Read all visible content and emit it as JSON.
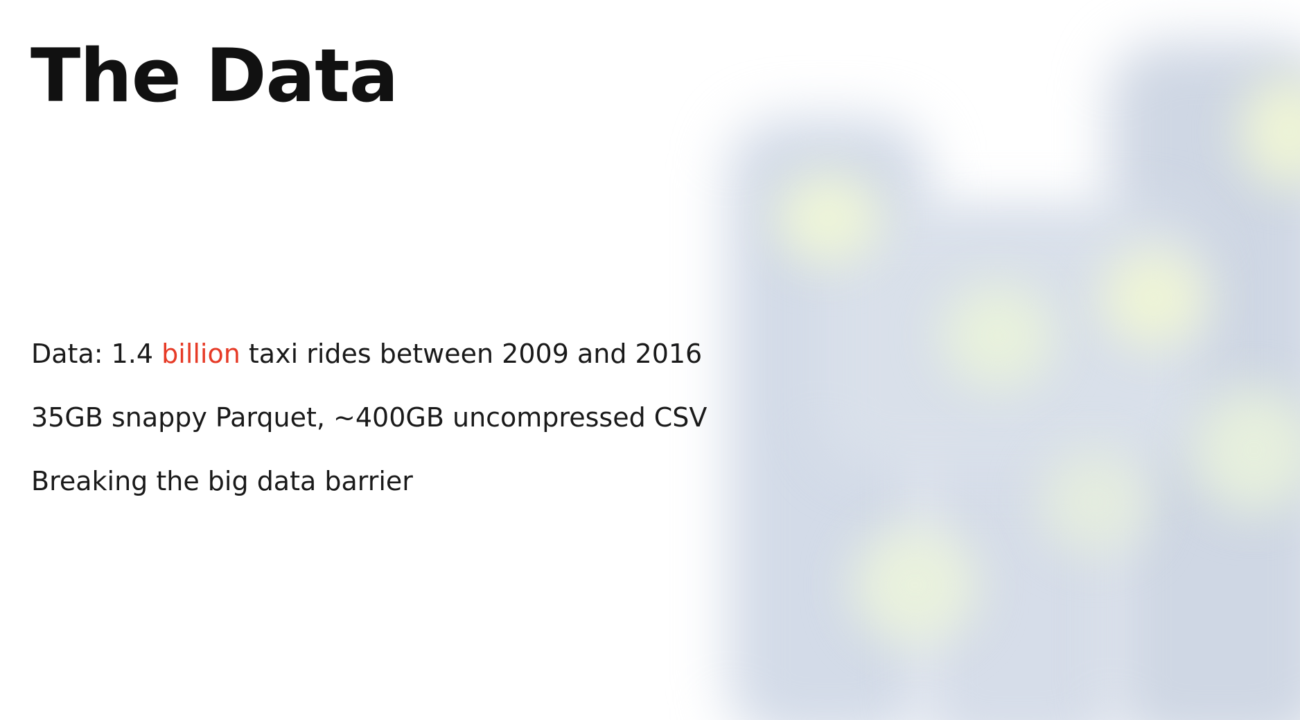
{
  "slide": {
    "title": "The Data",
    "accent_color": "#e63a26",
    "bullets": [
      {
        "before": "Data: 1.4 ",
        "highlight": "billion",
        "after": " taxi rides between 2009 and 2016"
      },
      {
        "text": "35GB snappy Parquet, ~400GB uncompressed CSV"
      },
      {
        "text": "Breaking the big data barrier"
      }
    ]
  }
}
